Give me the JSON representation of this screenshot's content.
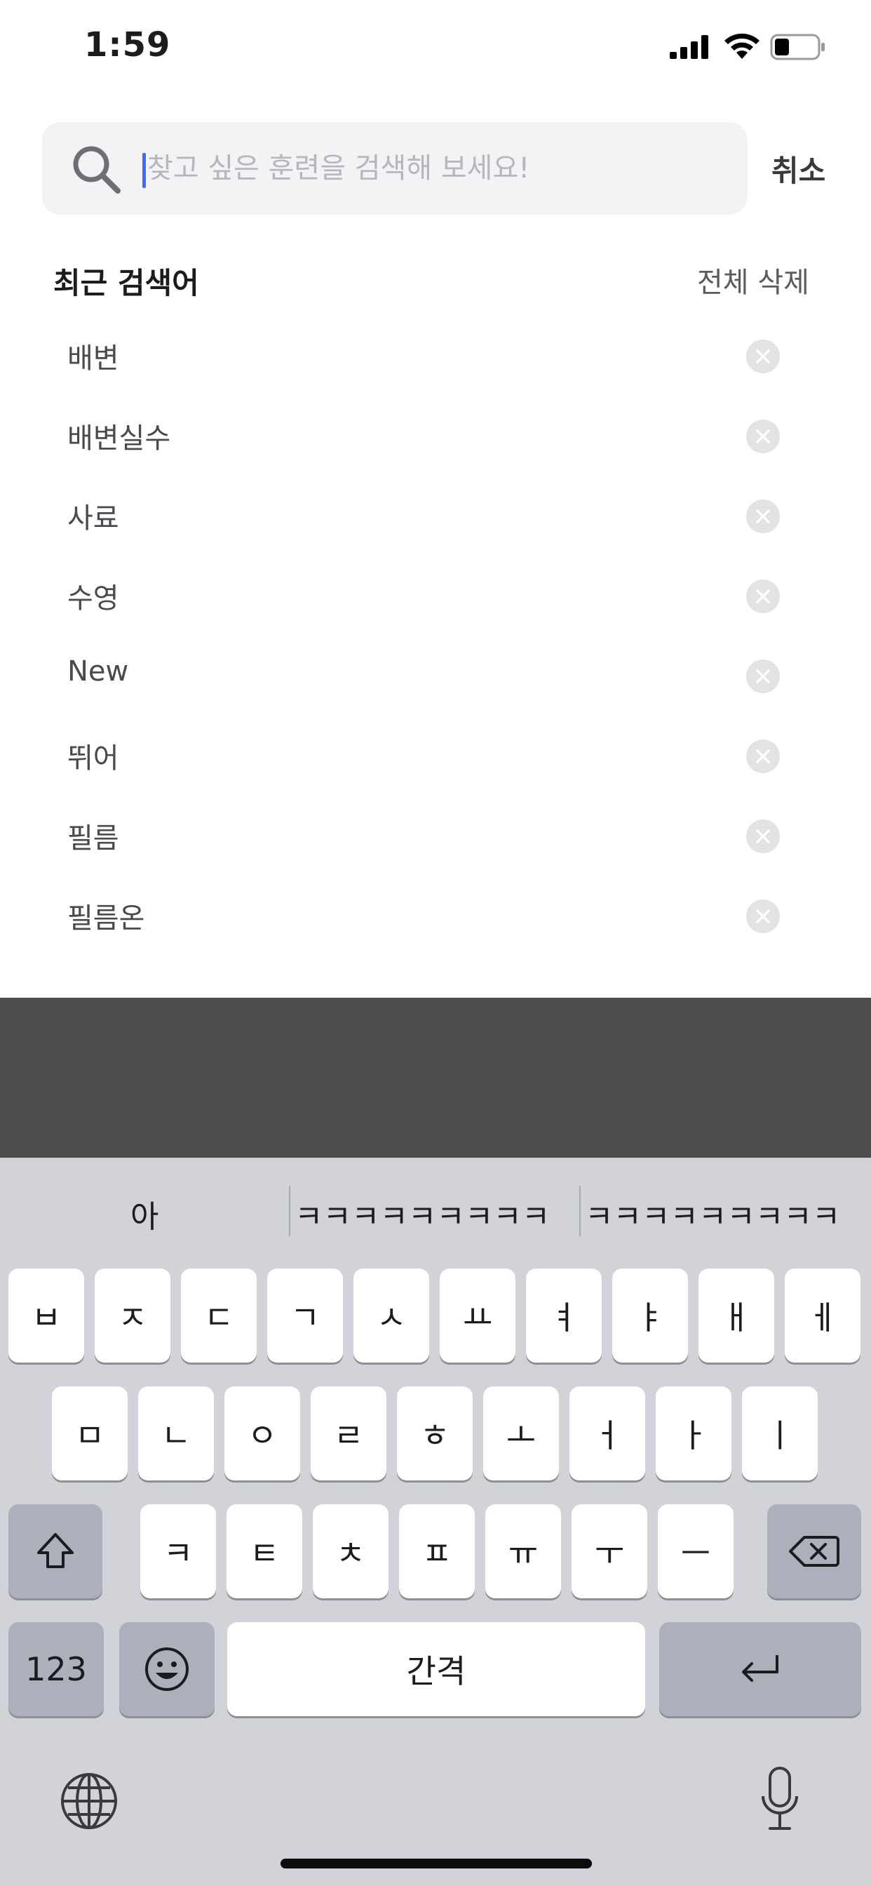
{
  "status_bar": {
    "time": "1:59"
  },
  "search": {
    "placeholder": "찾고 싶은 훈련을 검색해 보세요!",
    "value": "",
    "cancel_label": "취소"
  },
  "recent": {
    "title": "최근 검색어",
    "delete_all_label": "전체 삭제",
    "items": [
      "배변",
      "배변실수",
      "사료",
      "수영",
      "New",
      "뛰어",
      "필름",
      "필름온"
    ]
  },
  "keyboard": {
    "predictions": [
      "아",
      "ㅋㅋㅋㅋㅋㅋㅋㅋㅋ",
      "ㅋㅋㅋㅋㅋㅋㅋㅋㅋ"
    ],
    "row1": [
      "ㅂ",
      "ㅈ",
      "ㄷ",
      "ㄱ",
      "ㅅ",
      "ㅛ",
      "ㅕ",
      "ㅑ",
      "ㅐ",
      "ㅔ"
    ],
    "row2": [
      "ㅁ",
      "ㄴ",
      "ㅇ",
      "ㄹ",
      "ㅎ",
      "ㅗ",
      "ㅓ",
      "ㅏ",
      "ㅣ"
    ],
    "row3": [
      "ㅋ",
      "ㅌ",
      "ㅊ",
      "ㅍ",
      "ㅠ",
      "ㅜ",
      "ㅡ"
    ],
    "numbers_label": "123",
    "space_label": "간격",
    "icons": {
      "shift": "shift-icon",
      "delete": "delete-icon",
      "emoji": "emoji-icon",
      "return": "return-icon",
      "globe": "globe-icon",
      "mic": "microphone-icon"
    }
  }
}
